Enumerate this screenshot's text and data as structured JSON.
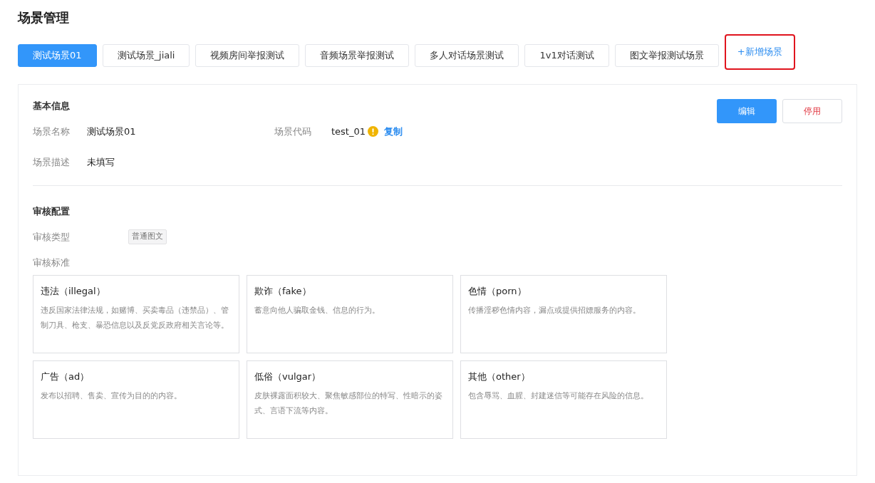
{
  "page_title": "场景管理",
  "tabs": [
    {
      "label": "测试场景01",
      "selected": true
    },
    {
      "label": "测试场景_jiali",
      "selected": false
    },
    {
      "label": "视频房间举报测试",
      "selected": false
    },
    {
      "label": "音频场景举报测试",
      "selected": false
    },
    {
      "label": "多人对话场景测试",
      "selected": false
    },
    {
      "label": "1v1对话测试",
      "selected": false
    },
    {
      "label": "图文举报测试场景",
      "selected": false
    }
  ],
  "add_tab": {
    "label": "+新增场景",
    "highlighted": true
  },
  "basic_info": {
    "heading": "基本信息",
    "edit_button": "编辑",
    "disable_button": "停用",
    "name_label": "场景名称",
    "name_value": "测试场景01",
    "code_label": "场景代码",
    "code_value": "test_01",
    "warning": true,
    "copy_link": "复制",
    "desc_label": "场景描述",
    "desc_value": "未填写"
  },
  "review_config": {
    "heading": "审核配置",
    "type_label": "审核类型",
    "type_tag": "普通图文",
    "standard_label": "审核标准",
    "standards": [
      {
        "title": "违法（illegal）",
        "description": "违反国家法律法规，如赌博、买卖毒品（违禁品）、管制刀具、枪支、暴恐信息以及反党反政府相关言论等。"
      },
      {
        "title": "欺诈（fake）",
        "description": "蓄意向他人骗取金钱、信息的行为。"
      },
      {
        "title": "色情（porn）",
        "description": "传播淫秽色情内容，漏点或提供招嫖服务的内容。"
      },
      {
        "title": "广告（ad）",
        "description": "发布以招聘、售卖、宣传为目的的内容。"
      },
      {
        "title": "低俗（vulgar）",
        "description": "皮肤裸露面积较大、聚焦敏感部位的特写、性暗示的姿式、言语下流等内容。"
      },
      {
        "title": "其他（other）",
        "description": "包含辱骂、血腥、封建迷信等可能存在风险的信息。"
      }
    ]
  }
}
